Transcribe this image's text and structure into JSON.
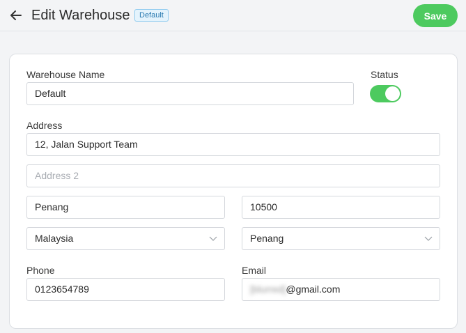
{
  "header": {
    "title": "Edit Warehouse",
    "badge": "Default",
    "save_label": "Save",
    "back_icon": "arrow-left-icon"
  },
  "form": {
    "warehouse_name": {
      "label": "Warehouse Name",
      "value": "Default"
    },
    "status": {
      "label": "Status",
      "enabled": true
    },
    "address": {
      "label": "Address",
      "value": "12, Jalan Support Team"
    },
    "address2": {
      "value": "",
      "placeholder": "Address 2"
    },
    "city": {
      "value": "Penang"
    },
    "postcode": {
      "value": "10500"
    },
    "country": {
      "value": "Malaysia"
    },
    "state": {
      "value": "Penang"
    },
    "phone": {
      "label": "Phone",
      "value": "0123654789"
    },
    "email": {
      "label": "Email",
      "value_hidden": "[blurred]",
      "value_domain": "@gmail.com"
    }
  },
  "colors": {
    "accent": "#4dca5f",
    "badge_text": "#2a7ab0",
    "badge_bg": "#e4f3fc"
  }
}
